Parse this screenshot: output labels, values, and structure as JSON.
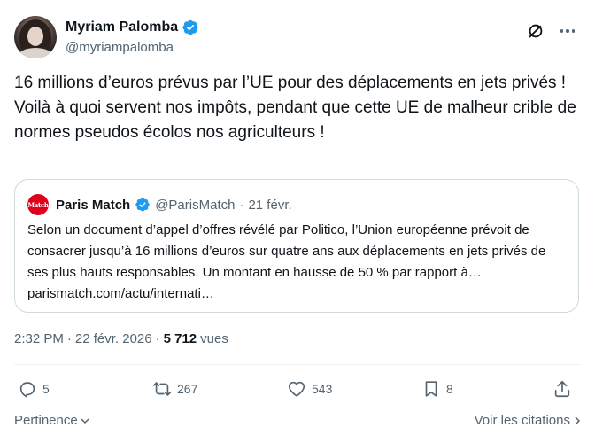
{
  "author": {
    "display_name": "Myriam Palomba",
    "handle": "@myriampalomba"
  },
  "tweet": {
    "paragraphs": [
      "16 millions d’euros prévus par l’UE pour des déplacements en jets privés !",
      "Voilà à quoi servent nos impôts, pendant que cette UE de malheur crible de normes pseudos écolos nos agriculteurs !"
    ]
  },
  "quote": {
    "logo_text": "Match",
    "name": "Paris Match",
    "handle": "@ParisMatch",
    "separator": "·",
    "date": "21 févr.",
    "text": "Selon un document d’appel d’offres révélé par Politico, l’Union européenne prévoit de consacrer jusqu’à 16 millions d’euros sur quatre ans aux déplacements en jets privés de ses plus hauts responsables. Un montant en hausse de 50 % par rapport à… parismatch.com/actu/internati…"
  },
  "meta": {
    "time": "2:32 PM",
    "separator": "·",
    "date": "22 févr. 2026",
    "views_count": "5 712",
    "views_label": "vues"
  },
  "actions": {
    "replies": "5",
    "reposts": "267",
    "likes": "543",
    "bookmarks": "8"
  },
  "footer": {
    "sort_label": "Pertinence",
    "quotes_label": "Voir les citations"
  },
  "colors": {
    "verified": "#1d9bf0",
    "secondary_text": "#536471",
    "paris_match_red": "#e0001b"
  }
}
